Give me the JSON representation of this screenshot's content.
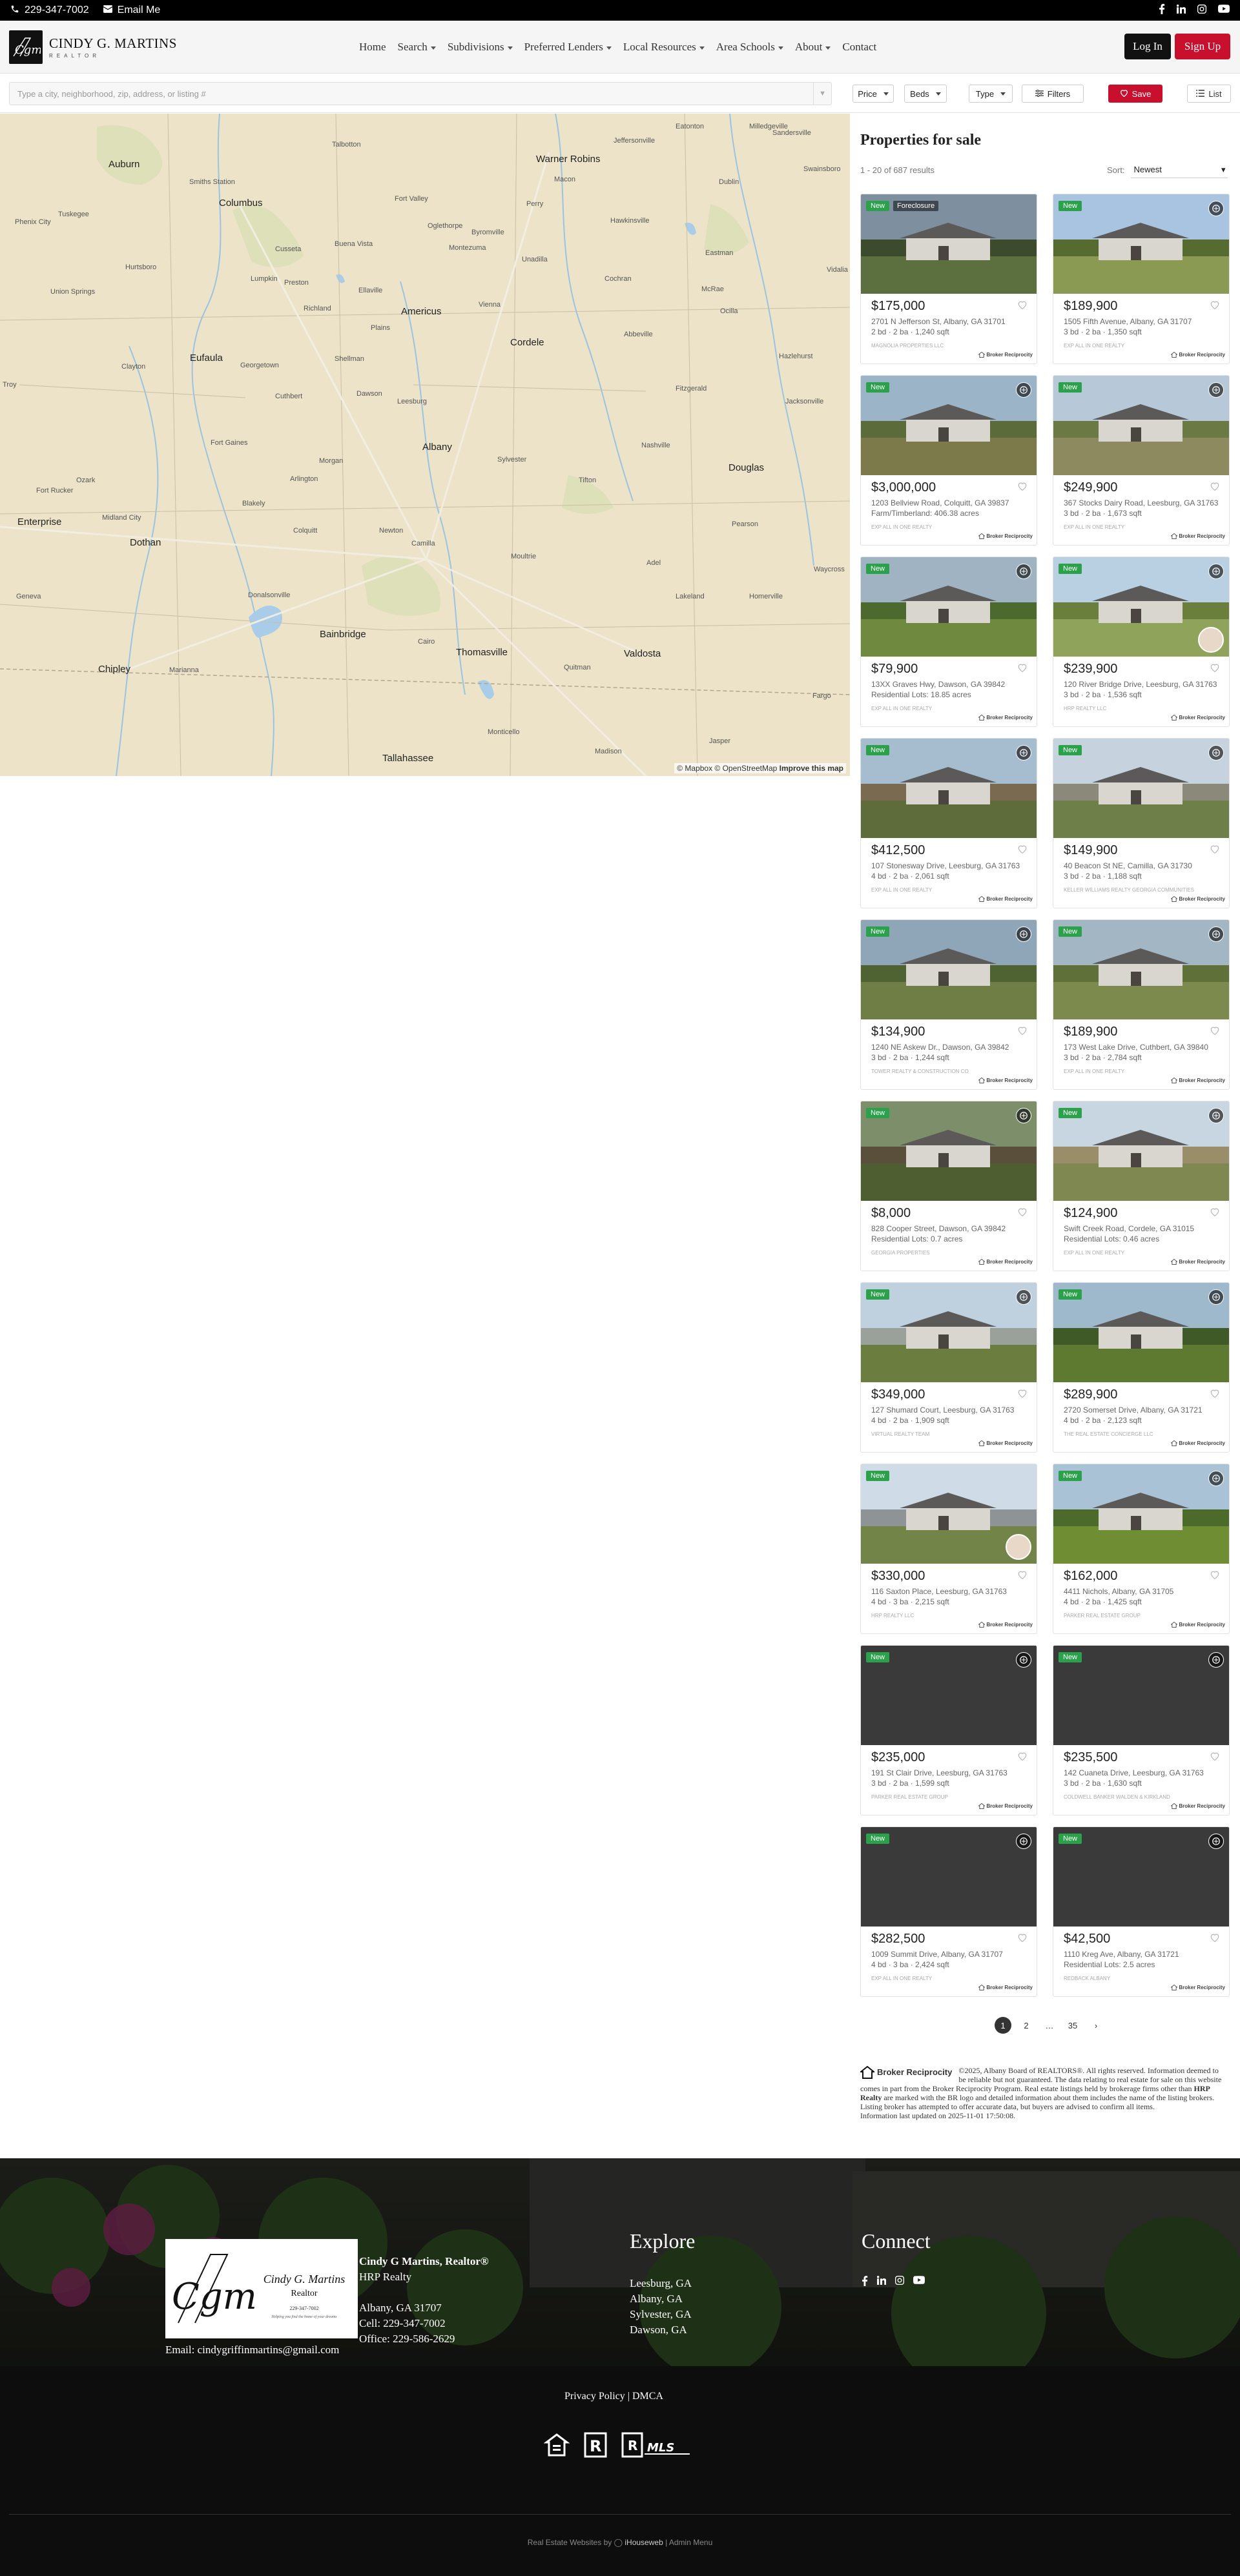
{
  "topbar": {
    "phone": "229-347-7002",
    "email_label": "Email Me"
  },
  "brand": {
    "name": "CINDY G. MARTINS",
    "sub": "REALTOR"
  },
  "nav": {
    "items": [
      {
        "label": "Home",
        "dropdown": false
      },
      {
        "label": "Search",
        "dropdown": true
      },
      {
        "label": "Subdivisions",
        "dropdown": true
      },
      {
        "label": "Preferred Lenders",
        "dropdown": true
      },
      {
        "label": "Local Resources",
        "dropdown": true
      },
      {
        "label": "Area Schools",
        "dropdown": true
      },
      {
        "label": "About",
        "dropdown": true
      },
      {
        "label": "Contact",
        "dropdown": false
      }
    ],
    "login": "Log In",
    "signup": "Sign Up"
  },
  "search": {
    "placeholder": "Type a city, neighborhood, zip, address, or listing #"
  },
  "filters": {
    "price": "Price",
    "beds": "Beds",
    "type": "Type",
    "more": "Filters",
    "save": "Save",
    "list": "List"
  },
  "map": {
    "credit": "© Mapbox © OpenStreetMap",
    "improve": "Improve this map",
    "cities": [
      "Auburn",
      "Columbus",
      "Tuskegee",
      "Smiths Station",
      "Phenix City",
      "Talbotton",
      "Warner Robins",
      "Macon",
      "Perry",
      "Fort Valley",
      "Cusseta",
      "Buena Vista",
      "Montezuma",
      "Americus",
      "Cordele",
      "Richland",
      "Ellaville",
      "Eufaula",
      "Georgetown",
      "Cuthbert",
      "Dawson",
      "Albany",
      "Sylvester",
      "Tifton",
      "Ozark",
      "Fort Rucker",
      "Enterprise",
      "Dothan",
      "Midland City",
      "Blakely",
      "Camilla",
      "Moultrie",
      "Bainbridge",
      "Cairo",
      "Thomasville",
      "Valdosta",
      "Quitman",
      "Donalsonville",
      "Geneva",
      "Chipley",
      "Marianna",
      "Tallahassee",
      "Monticello",
      "Madison",
      "Jasper",
      "Jeffersonville",
      "Dublin",
      "Hawkinsville",
      "Abbeville",
      "Ocilla",
      "Douglas",
      "Nashville",
      "Adel",
      "Lakeland",
      "Homerville",
      "Pearson",
      "Leesburg",
      "Fitzgerald",
      "Eastman",
      "McRae",
      "Vienna",
      "Unadilla",
      "Plains",
      "Shellman",
      "Morgan",
      "Arlington",
      "Colquitt",
      "Newton",
      "Fort Gaines",
      "Troy",
      "Clayton",
      "Union Springs",
      "Hurtsboro",
      "Lumpkin",
      "Preston",
      "Oglethorpe",
      "Byromville",
      "Fargo",
      "Waycross",
      "Vidalia",
      "Hazlehurst",
      "Jacksonville",
      "Sandersville",
      "Swainsboro",
      "Cochran",
      "Eatonton",
      "Milledgeville"
    ]
  },
  "listings_panel": {
    "title": "Properties for sale",
    "count": "1 - 20 of 687 results",
    "sort_label": "Sort:",
    "sort_value": "Newest"
  },
  "listings": [
    {
      "price": "$175,000",
      "address": "2701 N Jefferson St, Albany, GA 31701",
      "specs": "2 bd · 2 ba · 1,240 sqft",
      "brokerage": "Magnolia Properties LLC",
      "tag": "New",
      "tag2": "Foreclosure",
      "vt": false,
      "agent": false,
      "photo": [
        "#7e8fa0",
        "#3c4b2c",
        "#5c6f3f"
      ]
    },
    {
      "price": "$189,900",
      "address": "1505 Fifth Avenue, Albany, GA 31707",
      "specs": "3 bd · 2 ba · 1,350 sqft",
      "brokerage": "EXP ALL IN ONE REALTY",
      "tag": "New",
      "tag2": "",
      "vt": true,
      "agent": false,
      "photo": [
        "#a8c4e0",
        "#556b2f",
        "#8a9a52"
      ]
    },
    {
      "price": "$3,000,000",
      "address": "1203 Bellview Road, Colquitt, GA 39837",
      "specs": "Farm/Timberland: 406.38 acres",
      "brokerage": "EXP ALL IN ONE REALTY",
      "tag": "New",
      "tag2": "",
      "vt": true,
      "agent": false,
      "photo": [
        "#9bb4c8",
        "#5b6b3a",
        "#7c7a4a"
      ]
    },
    {
      "price": "$249,900",
      "address": "367 Stocks Dairy Road, Leesburg, GA 31763",
      "specs": "3 bd · 2 ba · 1,673 sqft",
      "brokerage": "EXP ALL IN ONE REALTY",
      "tag": "New",
      "tag2": "",
      "vt": true,
      "agent": false,
      "photo": [
        "#b7c9d8",
        "#6b7a44",
        "#8c8a5e"
      ]
    },
    {
      "price": "$79,900",
      "address": "13XX Graves Hwy, Dawson, GA 39842",
      "specs": "Residential Lots: 18.85 acres",
      "brokerage": "EXP ALL IN ONE REALTY",
      "tag": "New",
      "tag2": "",
      "vt": true,
      "agent": false,
      "photo": [
        "#9fb3c2",
        "#4d6a2e",
        "#6f8a3e"
      ]
    },
    {
      "price": "$239,900",
      "address": "120 River Bridge Drive, Leesburg, GA 31763",
      "specs": "3 bd · 2 ba · 1,536 sqft",
      "brokerage": "HRp Realty LLC",
      "tag": "New",
      "tag2": "",
      "vt": true,
      "agent": true,
      "photo": [
        "#b9cfe2",
        "#6a7f3c",
        "#8fa35a"
      ]
    },
    {
      "price": "$412,500",
      "address": "107 Stonesway Drive, Leesburg, GA 31763",
      "specs": "4 bd · 2 ba · 2,061 sqft",
      "brokerage": "EXP ALL IN ONE REALTY",
      "tag": "New",
      "tag2": "",
      "vt": true,
      "agent": false,
      "photo": [
        "#a6bccf",
        "#7a6a50",
        "#5e6b3a"
      ]
    },
    {
      "price": "$149,900",
      "address": "40 Beacon St NE, Camilla, GA 31730",
      "specs": "3 bd · 2 ba · 1,188 sqft",
      "brokerage": "KELLER WILLIAMS REALTY GEORGIA COMMUNITIES",
      "tag": "New",
      "tag2": "",
      "vt": true,
      "agent": false,
      "photo": [
        "#c6d3de",
        "#8b8a7a",
        "#6f7f4a"
      ]
    },
    {
      "price": "$134,900",
      "address": "1240 NE Askew Dr., Dawson, GA 39842",
      "specs": "3 bd · 2 ba · 1,244 sqft",
      "brokerage": "TOWER REALTY & CONSTRUCTION CO",
      "tag": "New",
      "tag2": "",
      "vt": true,
      "agent": false,
      "photo": [
        "#8fa6b8",
        "#4f6332",
        "#6e7e44"
      ]
    },
    {
      "price": "$189,900",
      "address": "173 West Lake Drive, Cuthbert, GA 39840",
      "specs": "3 bd · 2 ba · 2,784 sqft",
      "brokerage": "EXP ALL IN ONE REALTY",
      "tag": "New",
      "tag2": "",
      "vt": true,
      "agent": false,
      "photo": [
        "#a2b6c4",
        "#5f7038",
        "#7d8a4e"
      ]
    },
    {
      "price": "$8,000",
      "address": "828 Cooper Street, Dawson, GA 39842",
      "specs": "Residential Lots: 0.7 acres",
      "brokerage": "Georgia Properties",
      "tag": "New",
      "tag2": "",
      "vt": true,
      "agent": false,
      "photo": [
        "#7d8f6a",
        "#5a4f3a",
        "#4e5e30"
      ]
    },
    {
      "price": "$124,900",
      "address": "Swift Creek Road, Cordele, GA 31015",
      "specs": "Residential Lots: 0.46 acres",
      "brokerage": "EXP ALL IN ONE REALTY",
      "tag": "New",
      "tag2": "",
      "vt": true,
      "agent": false,
      "photo": [
        "#c8d6e2",
        "#9a8e6a",
        "#7e8850"
      ]
    },
    {
      "price": "$349,000",
      "address": "127 Shumard Court, Leesburg, GA 31763",
      "specs": "4 bd · 2 ba · 1,909 sqft",
      "brokerage": "VIRTUAL REALTY TEAM",
      "tag": "New",
      "tag2": "",
      "vt": true,
      "agent": false,
      "photo": [
        "#bfd0df",
        "#9aa09a",
        "#6c7d40"
      ]
    },
    {
      "price": "$289,900",
      "address": "2720 Somerset Drive, Albany, GA 31721",
      "specs": "4 bd · 2 ba · 2,123 sqft",
      "brokerage": "THE REAL ESTATE CONCIERGE LLC",
      "tag": "New",
      "tag2": "",
      "vt": true,
      "agent": false,
      "photo": [
        "#9eb8cc",
        "#3f5a26",
        "#5d7a30"
      ]
    },
    {
      "price": "$330,000",
      "address": "116 Saxton Place, Leesburg, GA 31763",
      "specs": "4 bd · 3 ba · 2,215 sqft",
      "brokerage": "HRp Realty LLC",
      "tag": "New",
      "tag2": "",
      "vt": false,
      "agent": true,
      "photo": [
        "#cfdbe6",
        "#8e9396",
        "#728448"
      ]
    },
    {
      "price": "$162,000",
      "address": "4411 Nichols, Albany, GA 31705",
      "specs": "4 bd · 2 ba · 1,425 sqft",
      "brokerage": "PARKER REAL ESTATE GROUP",
      "tag": "New",
      "tag2": "",
      "vt": true,
      "agent": false,
      "photo": [
        "#a9c2d6",
        "#4c6a2a",
        "#6f8e34"
      ]
    },
    {
      "price": "$235,000",
      "address": "191 St Clair Drive, Leesburg, GA 31763",
      "specs": "3 bd · 2 ba · 1,599 sqft",
      "brokerage": "PARKER REAL ESTATE GROUP",
      "tag": "New",
      "tag2": "",
      "vt": true,
      "agent": false,
      "photo": [
        "#3a3a3a",
        "#333333",
        "#2e2e2e"
      ]
    },
    {
      "price": "$235,500",
      "address": "142 Cuaneta Drive, Leesburg, GA 31763",
      "specs": "3 bd · 2 ba · 1,630 sqft",
      "brokerage": "COLDWELL BANKER WALDEN & KIRKLAND",
      "tag": "New",
      "tag2": "",
      "vt": true,
      "agent": false,
      "photo": [
        "#3a3a3a",
        "#333333",
        "#2e2e2e"
      ]
    },
    {
      "price": "$282,500",
      "address": "1009 Summit Drive, Albany, GA 31707",
      "specs": "4 bd · 3 ba · 2,424 sqft",
      "brokerage": "EXP ALL IN ONE REALTY",
      "tag": "New",
      "tag2": "",
      "vt": true,
      "agent": false,
      "photo": [
        "#3a3a3a",
        "#333333",
        "#2e2e2e"
      ]
    },
    {
      "price": "$42,500",
      "address": "1110 Kreg Ave, Albany, GA 31721",
      "specs": "Residential Lots: 2.5 acres",
      "brokerage": "REDBACK ALBANY",
      "tag": "New",
      "tag2": "",
      "vt": true,
      "agent": false,
      "photo": [
        "#3a3a3a",
        "#333333",
        "#2e2e2e"
      ]
    }
  ],
  "pagination": {
    "pages": [
      "1",
      "2",
      "…",
      "35"
    ],
    "next": "›"
  },
  "disclaimer": {
    "logo_text": "Broker Reciprocity",
    "text": "©2025, Albany Board of REALTORS®. All rights reserved. Information deemed to be reliable but not guaranteed. The data relating to real estate for sale on this website comes in part from the Broker Reciprocity Program. Real estate listings held by brokerage firms other than",
    "bold": "HRP Realty",
    "text2": "are marked with the BR logo and detailed information about them includes the name of the listing brokers. Listing broker has attempted to offer accurate data, but buyers are advised to confirm all items.",
    "updated": "Information last updated on 2025-11-01 17:50:08."
  },
  "footer": {
    "card_name": "Cindy G. Martins",
    "card_title": "Realtor",
    "card_phone": "229-347-7002",
    "card_tag": "Helping you find the home of your dreams",
    "contact_name": "Cindy G Martins, Realtor®",
    "company": "HRP Realty",
    "city": "Albany, GA 31707",
    "cell": "Cell: 229-347-7002",
    "office": "Office: 229-586-2629",
    "email": "Email: cindygriffinmartins@gmail.com",
    "explore_title": "Explore",
    "explore_links": [
      "Leesburg, GA",
      "Albany, GA",
      "Sylvester, GA",
      "Dawson, GA"
    ],
    "connect_title": "Connect",
    "policy": "Privacy Policy | DMCA",
    "bottom_prefix": "Real Estate Websites by",
    "bottom_brand": "iHouseweb",
    "bottom_suffix": "| Admin Menu"
  },
  "colors": {
    "accent": "#c8102e",
    "new_badge": "#2aa14a",
    "dark": "#111111"
  }
}
